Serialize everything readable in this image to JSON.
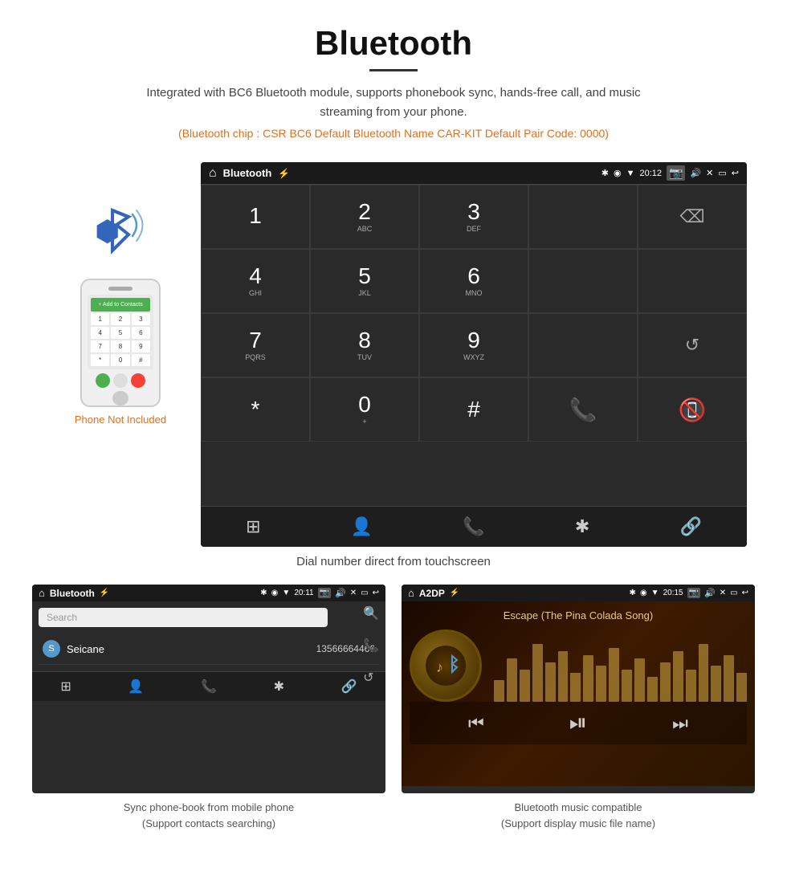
{
  "page": {
    "title": "Bluetooth",
    "subtitle": "Integrated with BC6 Bluetooth module, supports phonebook sync, hands-free call, and music streaming from your phone.",
    "chip_info": "(Bluetooth chip : CSR BC6    Default Bluetooth Name CAR-KIT    Default Pair Code: 0000)"
  },
  "dialscreen": {
    "app_name": "Bluetooth",
    "time": "20:12",
    "keys": [
      {
        "num": "1",
        "sub": ""
      },
      {
        "num": "2",
        "sub": "ABC"
      },
      {
        "num": "3",
        "sub": "DEF"
      },
      {
        "num": "",
        "sub": ""
      },
      {
        "num": "⌫",
        "sub": ""
      },
      {
        "num": "4",
        "sub": "GHI"
      },
      {
        "num": "5",
        "sub": "JKL"
      },
      {
        "num": "6",
        "sub": "MNO"
      },
      {
        "num": "",
        "sub": ""
      },
      {
        "num": "",
        "sub": ""
      },
      {
        "num": "7",
        "sub": "PQRS"
      },
      {
        "num": "8",
        "sub": "TUV"
      },
      {
        "num": "9",
        "sub": "WXYZ"
      },
      {
        "num": "",
        "sub": ""
      },
      {
        "num": "↺",
        "sub": ""
      },
      {
        "num": "*",
        "sub": ""
      },
      {
        "num": "0",
        "sub": "+"
      },
      {
        "num": "#",
        "sub": ""
      },
      {
        "num": "📞",
        "sub": ""
      },
      {
        "num": "📵",
        "sub": ""
      }
    ],
    "bottom_nav": [
      "⊞",
      "👤",
      "📞",
      "✱",
      "🔗"
    ]
  },
  "dial_caption": "Dial number direct from touchscreen",
  "phonebook_screen": {
    "app_name": "Bluetooth",
    "time": "20:11",
    "search_placeholder": "Search",
    "contacts": [
      {
        "initial": "S",
        "name": "Seicane",
        "number": "13566664466"
      }
    ],
    "side_icons": [
      "🔍",
      "📞",
      "↺"
    ],
    "bottom_nav": [
      "⊞",
      "👤",
      "📞",
      "✱",
      "🔗"
    ]
  },
  "music_screen": {
    "app_name": "A2DP",
    "time": "20:15",
    "song_title": "Escape (The Pina Colada Song)",
    "eq_bars": [
      30,
      60,
      45,
      80,
      55,
      70,
      40,
      65,
      50,
      75,
      45,
      60,
      35,
      55,
      70,
      45,
      80,
      50,
      65,
      40
    ],
    "controls": [
      "⏮",
      "⏯",
      "⏭"
    ]
  },
  "captions": {
    "phonebook": "Sync phone-book from mobile phone\n(Support contacts searching)",
    "music": "Bluetooth music compatible\n(Support display music file name)"
  },
  "phone_not_included": "Phone Not Included"
}
